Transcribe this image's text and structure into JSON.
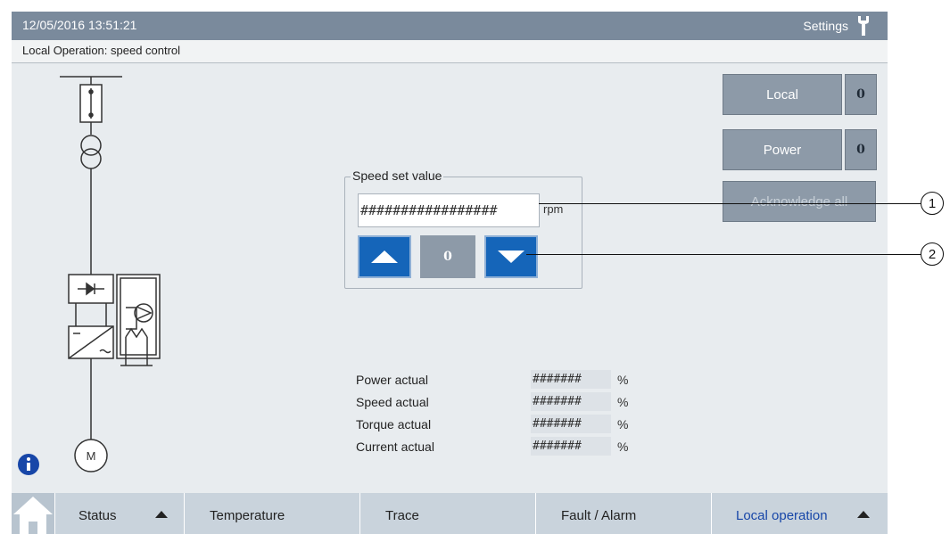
{
  "header": {
    "datetime": "12/05/2016 13:51:21",
    "settings_label": "Settings",
    "settings_icon": "wrench-icon"
  },
  "subtitle": "Local Operation: speed control",
  "side_buttons": {
    "local_label": "Local",
    "local_state": "0",
    "power_label": "Power",
    "power_state": "0",
    "acknowledge_label": "Acknowledge all"
  },
  "speed_set": {
    "group_label": "Speed set value",
    "input_value": "#################",
    "unit": "rpm",
    "up_icon": "triangle-up-icon",
    "zero_label": "0",
    "down_icon": "triangle-down-icon"
  },
  "actuals": [
    {
      "label": "Power actual",
      "value": "#######",
      "unit": "%"
    },
    {
      "label": "Speed actual",
      "value": "#######",
      "unit": "%"
    },
    {
      "label": "Torque actual",
      "value": "#######",
      "unit": "%"
    },
    {
      "label": "Current actual",
      "value": "#######",
      "unit": "%"
    }
  ],
  "diagram": {
    "motor_label": "M"
  },
  "nav": {
    "home_icon": "home-icon",
    "tabs": [
      {
        "label": "Status"
      },
      {
        "label": "Temperature"
      },
      {
        "label": "Trace"
      },
      {
        "label": "Fault / Alarm"
      },
      {
        "label": "Local operation"
      }
    ]
  },
  "callouts": [
    "1",
    "2"
  ],
  "colors": {
    "header_bg": "#7a8a9c",
    "button_blue": "#1565b9",
    "button_gray": "#8d9aa8",
    "active_tab_text": "#1746a8"
  }
}
